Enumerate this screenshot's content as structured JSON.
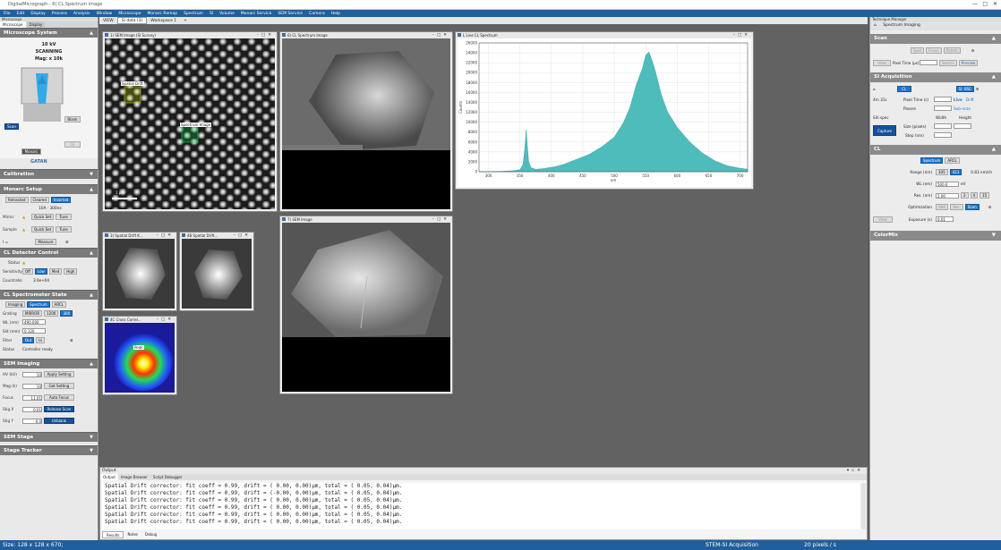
{
  "app": {
    "title": "DigitalMicrograph - 6) CL Spectrum image"
  },
  "menu": [
    "File",
    "Edit",
    "Display",
    "Process",
    "Analysis",
    "Window",
    "Microscope",
    "Monarc Remap",
    "Spectrum",
    "SI",
    "Volume",
    "Monarc Service",
    "SEM Service",
    "Camera",
    "Help"
  ],
  "left": {
    "header": "Microscope",
    "tabs": [
      "Microscope",
      "Display"
    ],
    "microscope_system": {
      "title": "Microscope System",
      "kv": "10 kV",
      "state": "SCANNING",
      "mag": "Mag: x 10k",
      "scan": "Scan",
      "blank": "Blank",
      "ce": "CE",
      "monarc": "Monarc",
      "brand": "GATAN"
    },
    "calibration": {
      "title": "Calibration"
    },
    "monarc_setup": {
      "title": "Monarc Setup",
      "modes": [
        "Retracted",
        "Cleared",
        "Inserted"
      ],
      "info": "10A - 300nx",
      "mirror": "Mirror",
      "sample": "Sample",
      "quick_set": "Quick Set",
      "tune": "Tune",
      "measure": "Measure",
      "i_label": "I ="
    },
    "cl_detector": {
      "title": "CL Detector Control",
      "status": "Status",
      "sensitivity": "Sensitivity",
      "sens_opts": [
        "Off",
        "Low",
        "Med",
        "High"
      ],
      "countrate": "Countrate:",
      "countrate_val": "3.6e+04"
    },
    "cl_spectrometer": {
      "title": "CL Spectrometer State",
      "modes": [
        "Imaging",
        "Spectrum",
        "ARCL"
      ],
      "grating": "Grating",
      "grating_opts": [
        "MIRROR",
        "1200",
        "300"
      ],
      "wl_label": "WL (nm)",
      "wl_val": "490.000",
      "slit_label": "Slit (mm)",
      "slit_val": "0.120",
      "filter": "Filter",
      "filter_opts": [
        "Out",
        "In"
      ],
      "status_label": "Status",
      "status_val": "Controller ready"
    },
    "sem_imaging": {
      "title": "SEM Imaging",
      "hv_label": "HV (kV)",
      "hv_val": "10",
      "mag_label": "Mag (k)",
      "mag_val": "10",
      "focus_label": "Focus",
      "focus_val": "11.01",
      "stigx_label": "Stig X",
      "stigx_val": "0.01",
      "stigy_label": "Stig Y",
      "stigy_val": "0.0",
      "apply": "Apply Setting",
      "get": "Get Setting",
      "autofocus": "Auto Focus",
      "release": "Release Scan",
      "unblank": "Unblank"
    },
    "sem_stage": {
      "title": "SEM Stage"
    },
    "stage_tracker": {
      "title": "Stage Tracker"
    }
  },
  "workspace": {
    "tabs": [
      "VIEW",
      "SI data (3)",
      "Workspace 1",
      "+"
    ],
    "windows": {
      "survey": "1) SEM Image (SI Survey)",
      "cl_si": "6) CL Spectrum Image",
      "live_cl": "L Live CL Spectrum",
      "spatial1": "3) Spatial Drift K...",
      "spatial2": "4B Spatial Drift...",
      "sem_image": "7) SEM Image",
      "cross": "4C Cross Correl..."
    },
    "survey_labels": {
      "drift": "Spatial Drift",
      "spectrum": "Spectrum Image",
      "scale": "1 µm"
    },
    "cross_label": "Peak"
  },
  "chart_data": {
    "type": "area",
    "title": "",
    "xlabel": "nm",
    "ylabel": "Counts",
    "xlim": [
      285,
      712
    ],
    "ylim": [
      0,
      26000
    ],
    "xticks": [
      300,
      350,
      400,
      450,
      500,
      550,
      600,
      650,
      700
    ],
    "yticks": [
      0,
      2000,
      4000,
      6000,
      8000,
      10000,
      12000,
      14000,
      16000,
      18000,
      20000,
      22000,
      24000,
      26000
    ],
    "x": [
      285,
      300,
      320,
      340,
      350,
      355,
      358,
      360,
      362,
      364,
      368,
      375,
      385,
      395,
      405,
      420,
      440,
      460,
      480,
      500,
      515,
      525,
      535,
      545,
      550,
      555,
      560,
      565,
      570,
      575,
      585,
      600,
      620,
      640,
      660,
      680,
      700,
      712
    ],
    "y": [
      0,
      60,
      80,
      200,
      400,
      1500,
      5000,
      8500,
      5000,
      2000,
      800,
      500,
      600,
      800,
      1000,
      1500,
      2500,
      3500,
      5000,
      7000,
      10000,
      13000,
      17500,
      21000,
      23500,
      24200,
      22500,
      20500,
      18000,
      15500,
      12000,
      9000,
      6000,
      3800,
      2200,
      1200,
      700,
      500
    ],
    "fill_color": "#4fbcbc"
  },
  "output": {
    "title": "Output",
    "tabs": [
      "Output",
      "Image Browser",
      "Script Debugger"
    ],
    "lines": [
      "Spatial Drift corrector: fit coeff = 0.99, drift = ( 0.00, 0.00)µm, total = ( 0.05, 0.04)µm.",
      "Spatial Drift corrector: fit coeff = 0.99, drift = (-0.00, 0.00)µm, total = ( 0.05, 0.04)µm.",
      "Spatial Drift corrector: fit coeff = 0.99, drift = ( 0.00, 0.00)µm, total = ( 0.05, 0.04)µm.",
      "Spatial Drift corrector: fit coeff = 0.99, drift = ( 0.00, 0.00)µm, total = ( 0.05, 0.04)µm.",
      "Spatial Drift corrector: fit coeff = 0.99, drift = ( 0.00, 0.00)µm, total = ( 0.05, 0.04)µm.",
      "Spatial Drift corrector: fit coeff = 0.99, drift = ( 0.00, 0.00)µm, total = ( 0.05, 0.04)µm."
    ],
    "bottom_tabs": [
      "Results",
      "Notes",
      "Debug"
    ]
  },
  "right": {
    "header": "Technique Manager",
    "technique": "Spectrum Imaging",
    "scan": {
      "title": "Scan",
      "spot": "Spot",
      "focus": "Focus",
      "rotate": "Rotate",
      "view": "View",
      "pixel_time": "Pixel Time (µs)",
      "search": "Search",
      "preview": "Preview"
    },
    "si_acq": {
      "title": "SI Acquisition",
      "cl": "CL",
      "si_beam": "SI: BSE",
      "time": "4m 31s",
      "pixel_time": "Pixel Time (s)",
      "live": "Live",
      "drift": "Drift",
      "passes": "Passes",
      "subscan": "Sub-scan",
      "siti_spec": "Siti spec",
      "width": "Width",
      "height": "Height",
      "size": "Size (pixels)",
      "step": "Step (nm)",
      "capture": "Capture"
    },
    "cl": {
      "title": "CL",
      "modes": [
        "Spectrum",
        "ARCL"
      ],
      "range": "Range (nm)",
      "range_lo": "105",
      "range_hi": "423",
      "range_unit": "0.83 nm/ch",
      "wl": "WL (nm)",
      "wl_val": "500.0",
      "wl_unit": "eV",
      "res": "Res. (nm)",
      "res_val": "2.00",
      "res_opts": [
        "2",
        "4",
        "15"
      ],
      "opt": "Optimization",
      "opt_opts": [
        "SNR",
        "Res.",
        "Slam"
      ],
      "view": "View",
      "exposure": "Exposure (s)",
      "exposure_val": "0.01"
    },
    "colormix": {
      "title": "ColorMix"
    }
  },
  "status": {
    "size": "Size: 128 x 128 x 670;",
    "mode": "STEM-SI Acquisition",
    "rate": "20 pixels / s"
  }
}
